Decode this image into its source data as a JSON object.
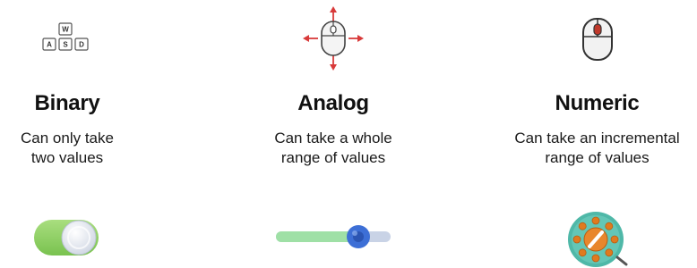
{
  "columns": [
    {
      "title": "Binary",
      "description_line1": "Can only take",
      "description_line2": "two values",
      "icon": "keyboard-keys-icon",
      "keys": [
        "W",
        "A",
        "S",
        "D"
      ],
      "control": "toggle-switch"
    },
    {
      "title": "Analog",
      "description_line1": "Can take a whole",
      "description_line2": "range of values",
      "icon": "mouse-move-arrows-icon",
      "control": "slider",
      "slider_value_fraction": 0.7
    },
    {
      "title": "Numeric",
      "description_line1": "Can take an incremental",
      "description_line2": "range of values",
      "icon": "mouse-scroll-wheel-icon",
      "control": "rotary-dial"
    }
  ],
  "colors": {
    "toggle_green": "#8fd16a",
    "slider_track": "#9fe0a6",
    "slider_track_empty": "#c9d3e6",
    "slider_knob": "#3d6fd6",
    "arrow_red": "#d83a3a",
    "mouse_wheel_red": "#c0392b",
    "dial_teal": "#4fb8a8",
    "dial_orange": "#e07a1f"
  }
}
